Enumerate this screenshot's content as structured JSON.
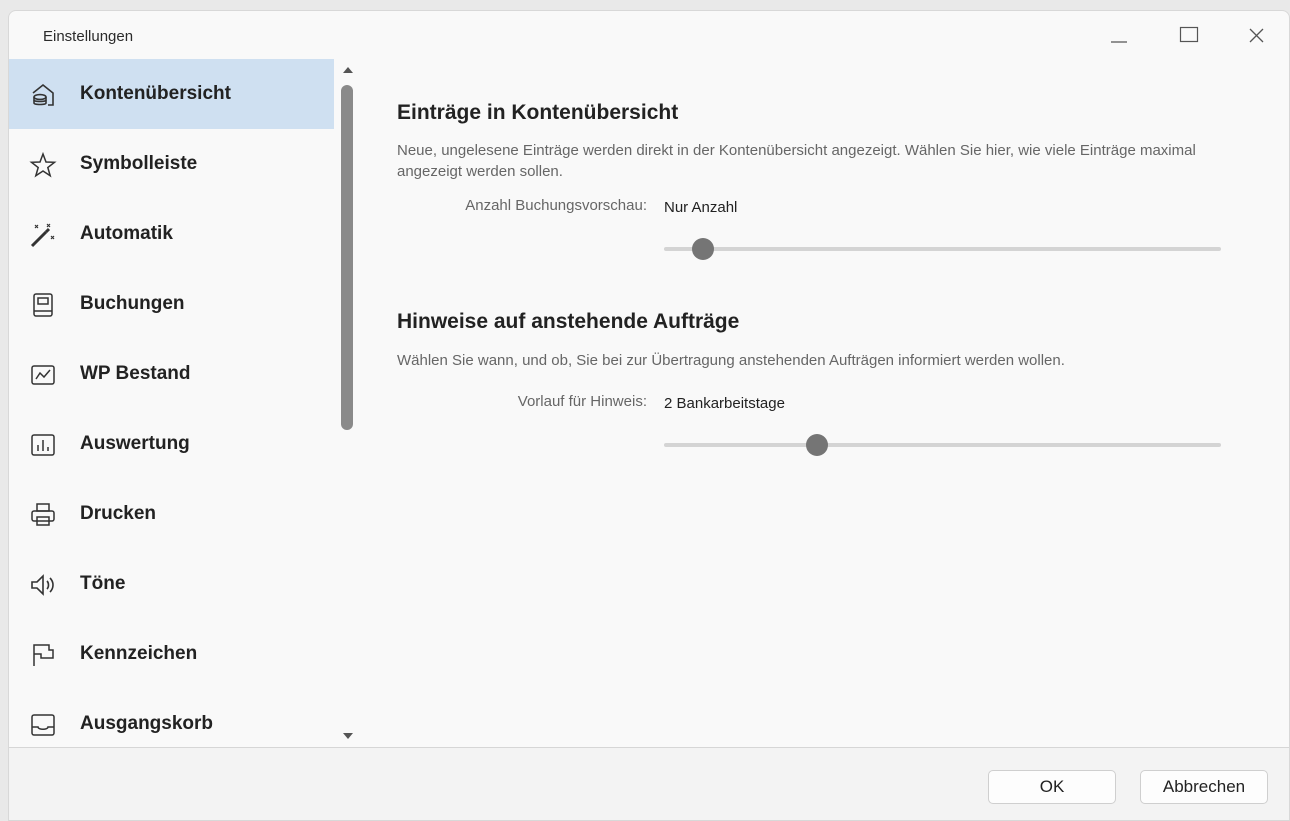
{
  "window": {
    "title": "Einstellungen"
  },
  "sidebar": {
    "items": [
      {
        "label": "Kontenübersicht",
        "icon": "account-overview-icon",
        "selected": true
      },
      {
        "label": "Symbolleiste",
        "icon": "star-icon",
        "selected": false
      },
      {
        "label": "Automatik",
        "icon": "magic-wand-icon",
        "selected": false
      },
      {
        "label": "Buchungen",
        "icon": "ledger-icon",
        "selected": false
      },
      {
        "label": "WP Bestand",
        "icon": "line-chart-icon",
        "selected": false
      },
      {
        "label": "Auswertung",
        "icon": "bar-chart-icon",
        "selected": false
      },
      {
        "label": "Drucken",
        "icon": "printer-icon",
        "selected": false
      },
      {
        "label": "Töne",
        "icon": "speaker-icon",
        "selected": false
      },
      {
        "label": "Kennzeichen",
        "icon": "flag-icon",
        "selected": false
      },
      {
        "label": "Ausgangskorb",
        "icon": "outbox-tray-icon",
        "selected": false
      }
    ]
  },
  "sections": [
    {
      "heading": "Einträge in Kontenübersicht",
      "description": "Neue, ungelesene Einträge werden direkt in der Kontenübersicht angezeigt. Wählen Sie hier, wie viele Einträge maximal angezeigt werden sollen.",
      "field_label": "Anzahl Buchungsvorschau:",
      "field_value": "Nur Anzahl",
      "slider_position": 0.07
    },
    {
      "heading": "Hinweise auf anstehende Aufträge",
      "description": "Wählen Sie wann, und ob, Sie bei zur Übertragung anstehenden Aufträgen informiert werden wollen.",
      "field_label": "Vorlauf für Hinweis:",
      "field_value": "2 Bankarbeitstage",
      "slider_position": 0.275
    }
  ],
  "footer": {
    "ok_label": "OK",
    "cancel_label": "Abbrechen"
  },
  "colors": {
    "selected_bg": "#cfe0f1",
    "slider_thumb": "#757575",
    "slider_track": "#d4d4d4"
  }
}
